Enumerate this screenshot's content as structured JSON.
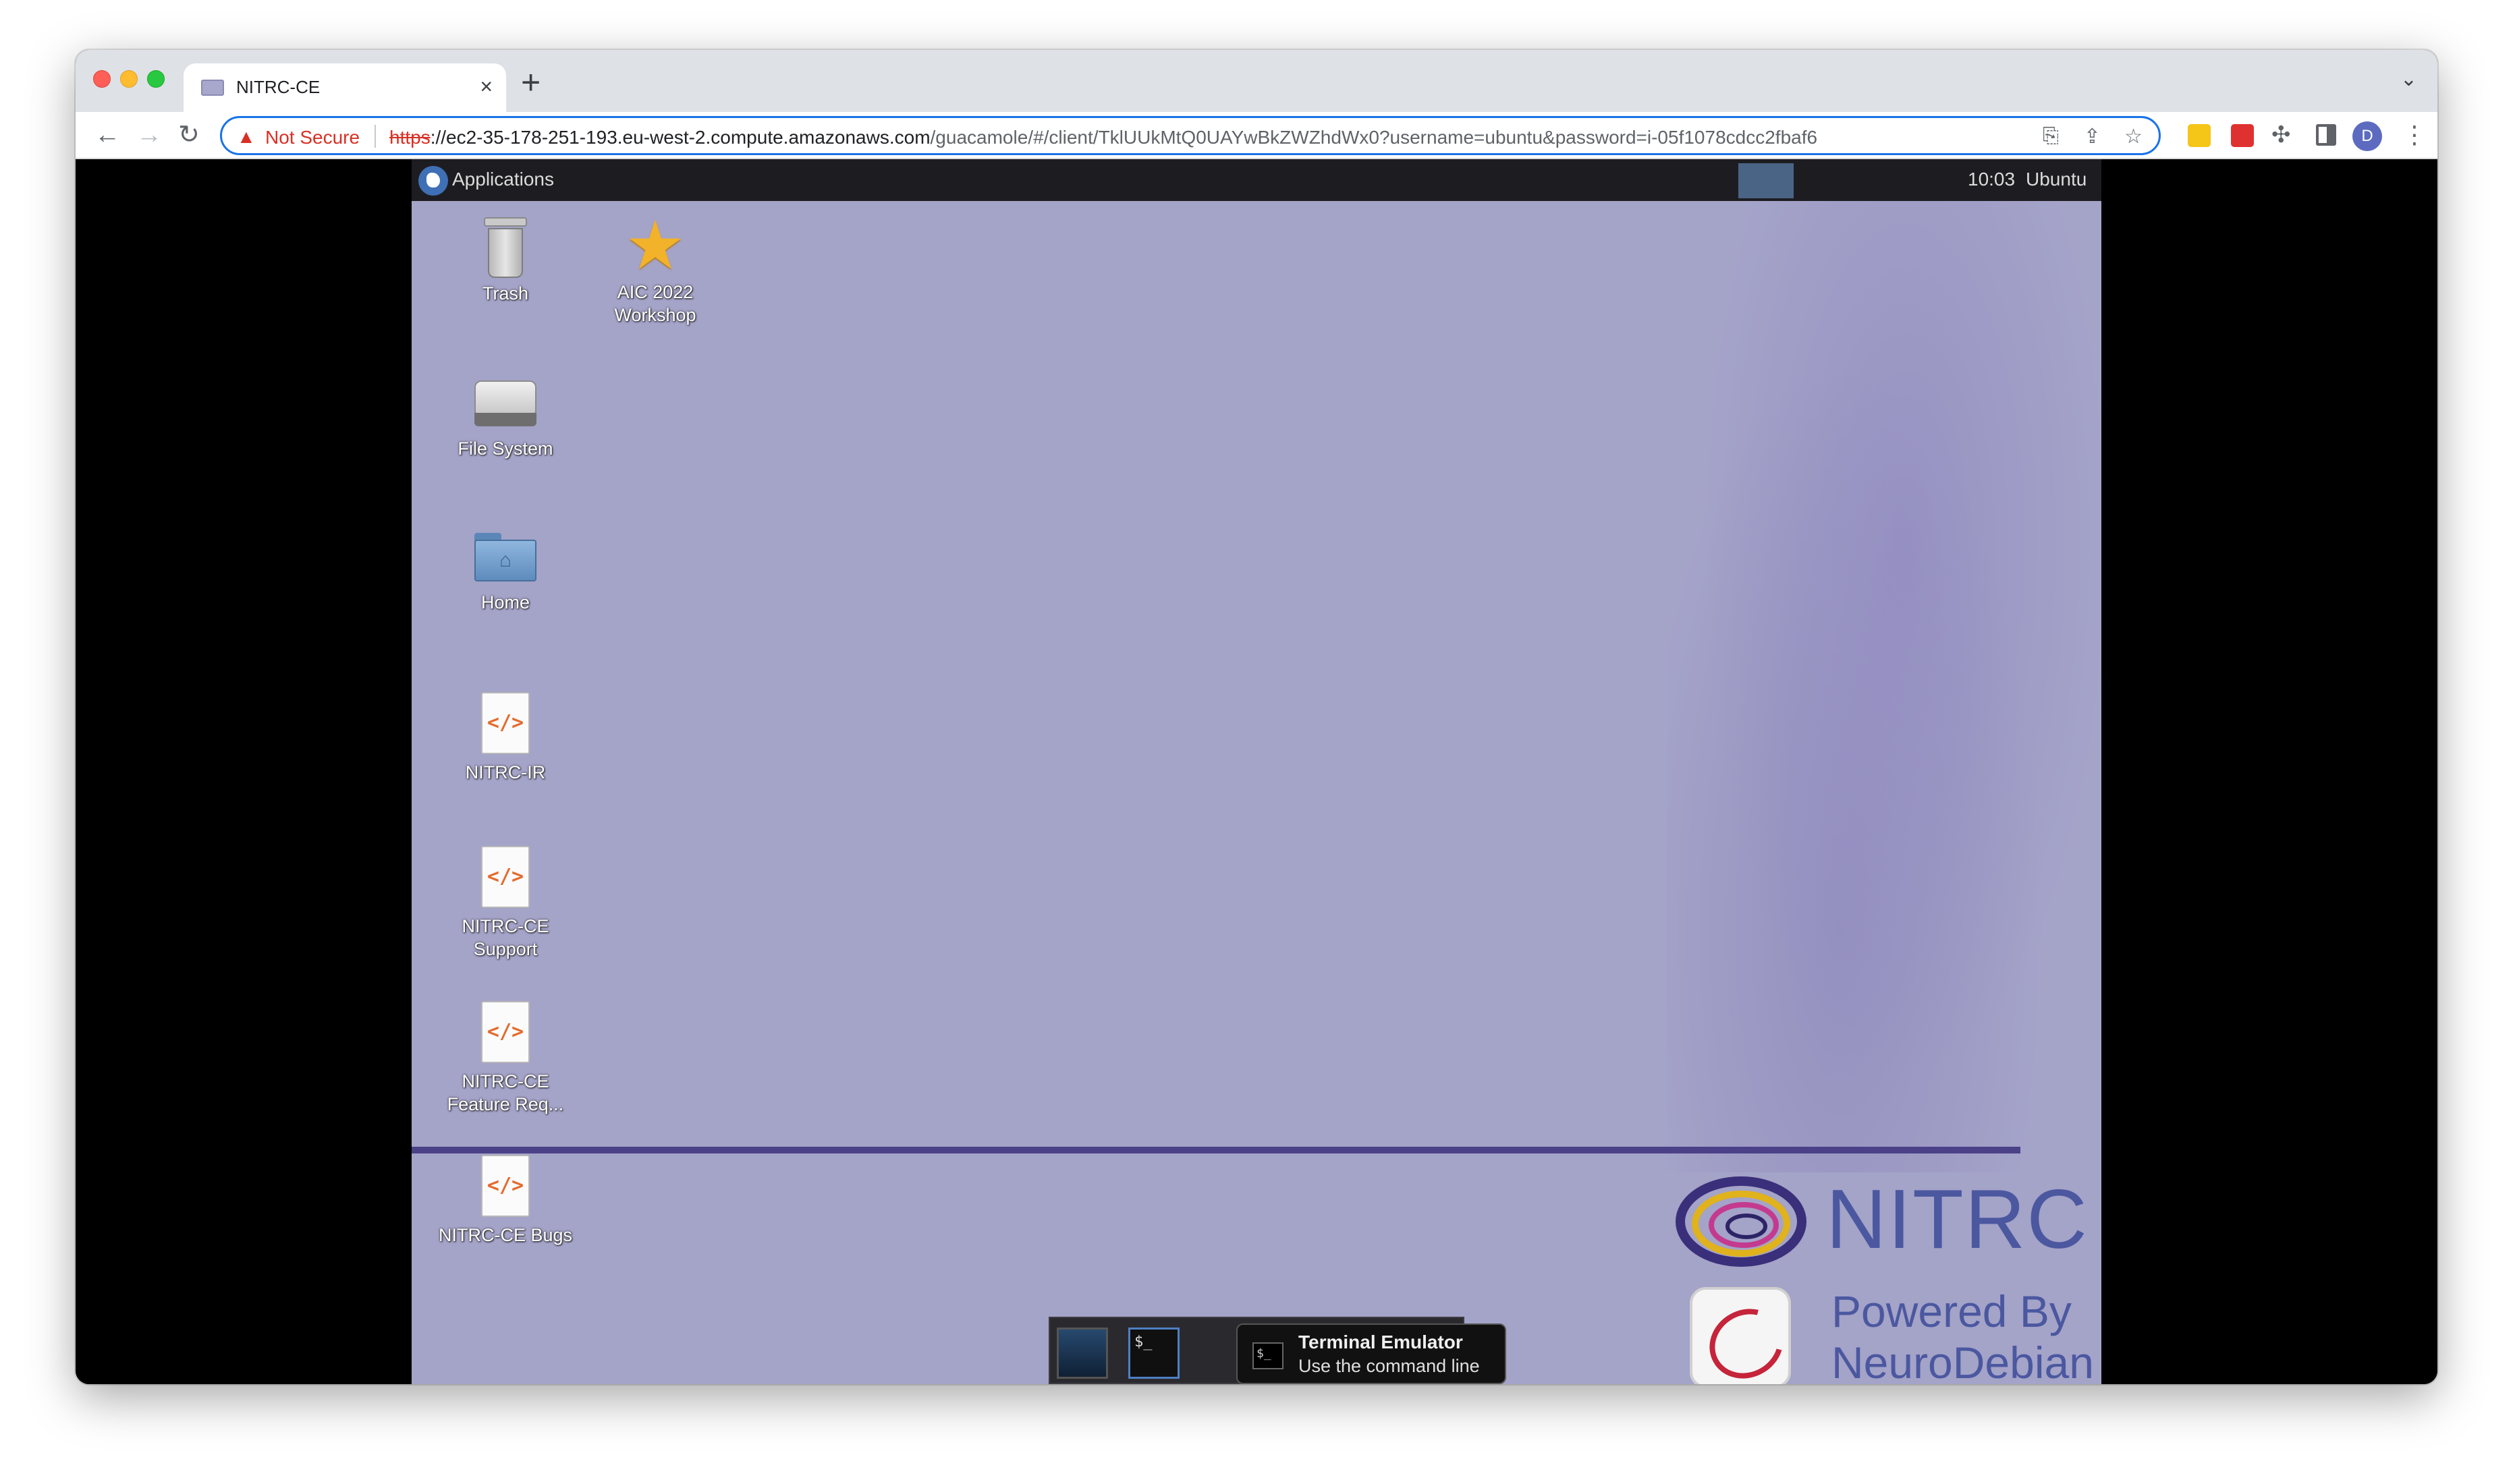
{
  "browser": {
    "tab_title": "NITRC-CE",
    "tab_close": "×",
    "new_tab": "+",
    "tab_search": "⌄",
    "back": "←",
    "forward": "→",
    "reload": "↻",
    "security_warning": "Not Secure",
    "url_scheme": "https",
    "url_host": "://ec2-35-178-251-193.eu-west-2.compute.amazonaws.com",
    "url_path": "/guacamole/#/client/TklUUkMtQ0UAYwBkZWZhdWx0?username=ubuntu&password=i-05f1078cdcc2fbaf6",
    "profile_initial": "D",
    "menu": "⋮",
    "accent_color": "#1a73e8",
    "warning_color": "#d93025"
  },
  "desktop": {
    "panel": {
      "applications_label": "Applications",
      "clock": "10:03",
      "user": "Ubuntu"
    },
    "icons": [
      {
        "label": "Trash",
        "icon": "trash-icon"
      },
      {
        "label": "AIC 2022 Workshop",
        "icon": "star-icon"
      },
      {
        "label": "File System",
        "icon": "drive-icon"
      },
      {
        "label": "Home",
        "icon": "home-folder-icon"
      },
      {
        "label": "NITRC-IR",
        "icon": "html-doc-icon"
      },
      {
        "label": "NITRC-CE Support",
        "icon": "html-doc-icon"
      },
      {
        "label": "NITRC-CE Feature Req...",
        "icon": "html-doc-icon"
      },
      {
        "label": "NITRC-CE Bugs",
        "icon": "html-doc-icon"
      }
    ],
    "doc_glyph": "</>",
    "home_glyph": "⌂",
    "star_glyph": "★",
    "branding": {
      "nitrc": "NITRC",
      "powered_line1": "Powered By",
      "powered_line2": "NeuroDebian"
    },
    "dock": {
      "terminal_glyph": "$_",
      "tooltip_title": "Terminal Emulator",
      "tooltip_subtitle": "Use the command line"
    },
    "background_color": "#a4a3c8"
  }
}
